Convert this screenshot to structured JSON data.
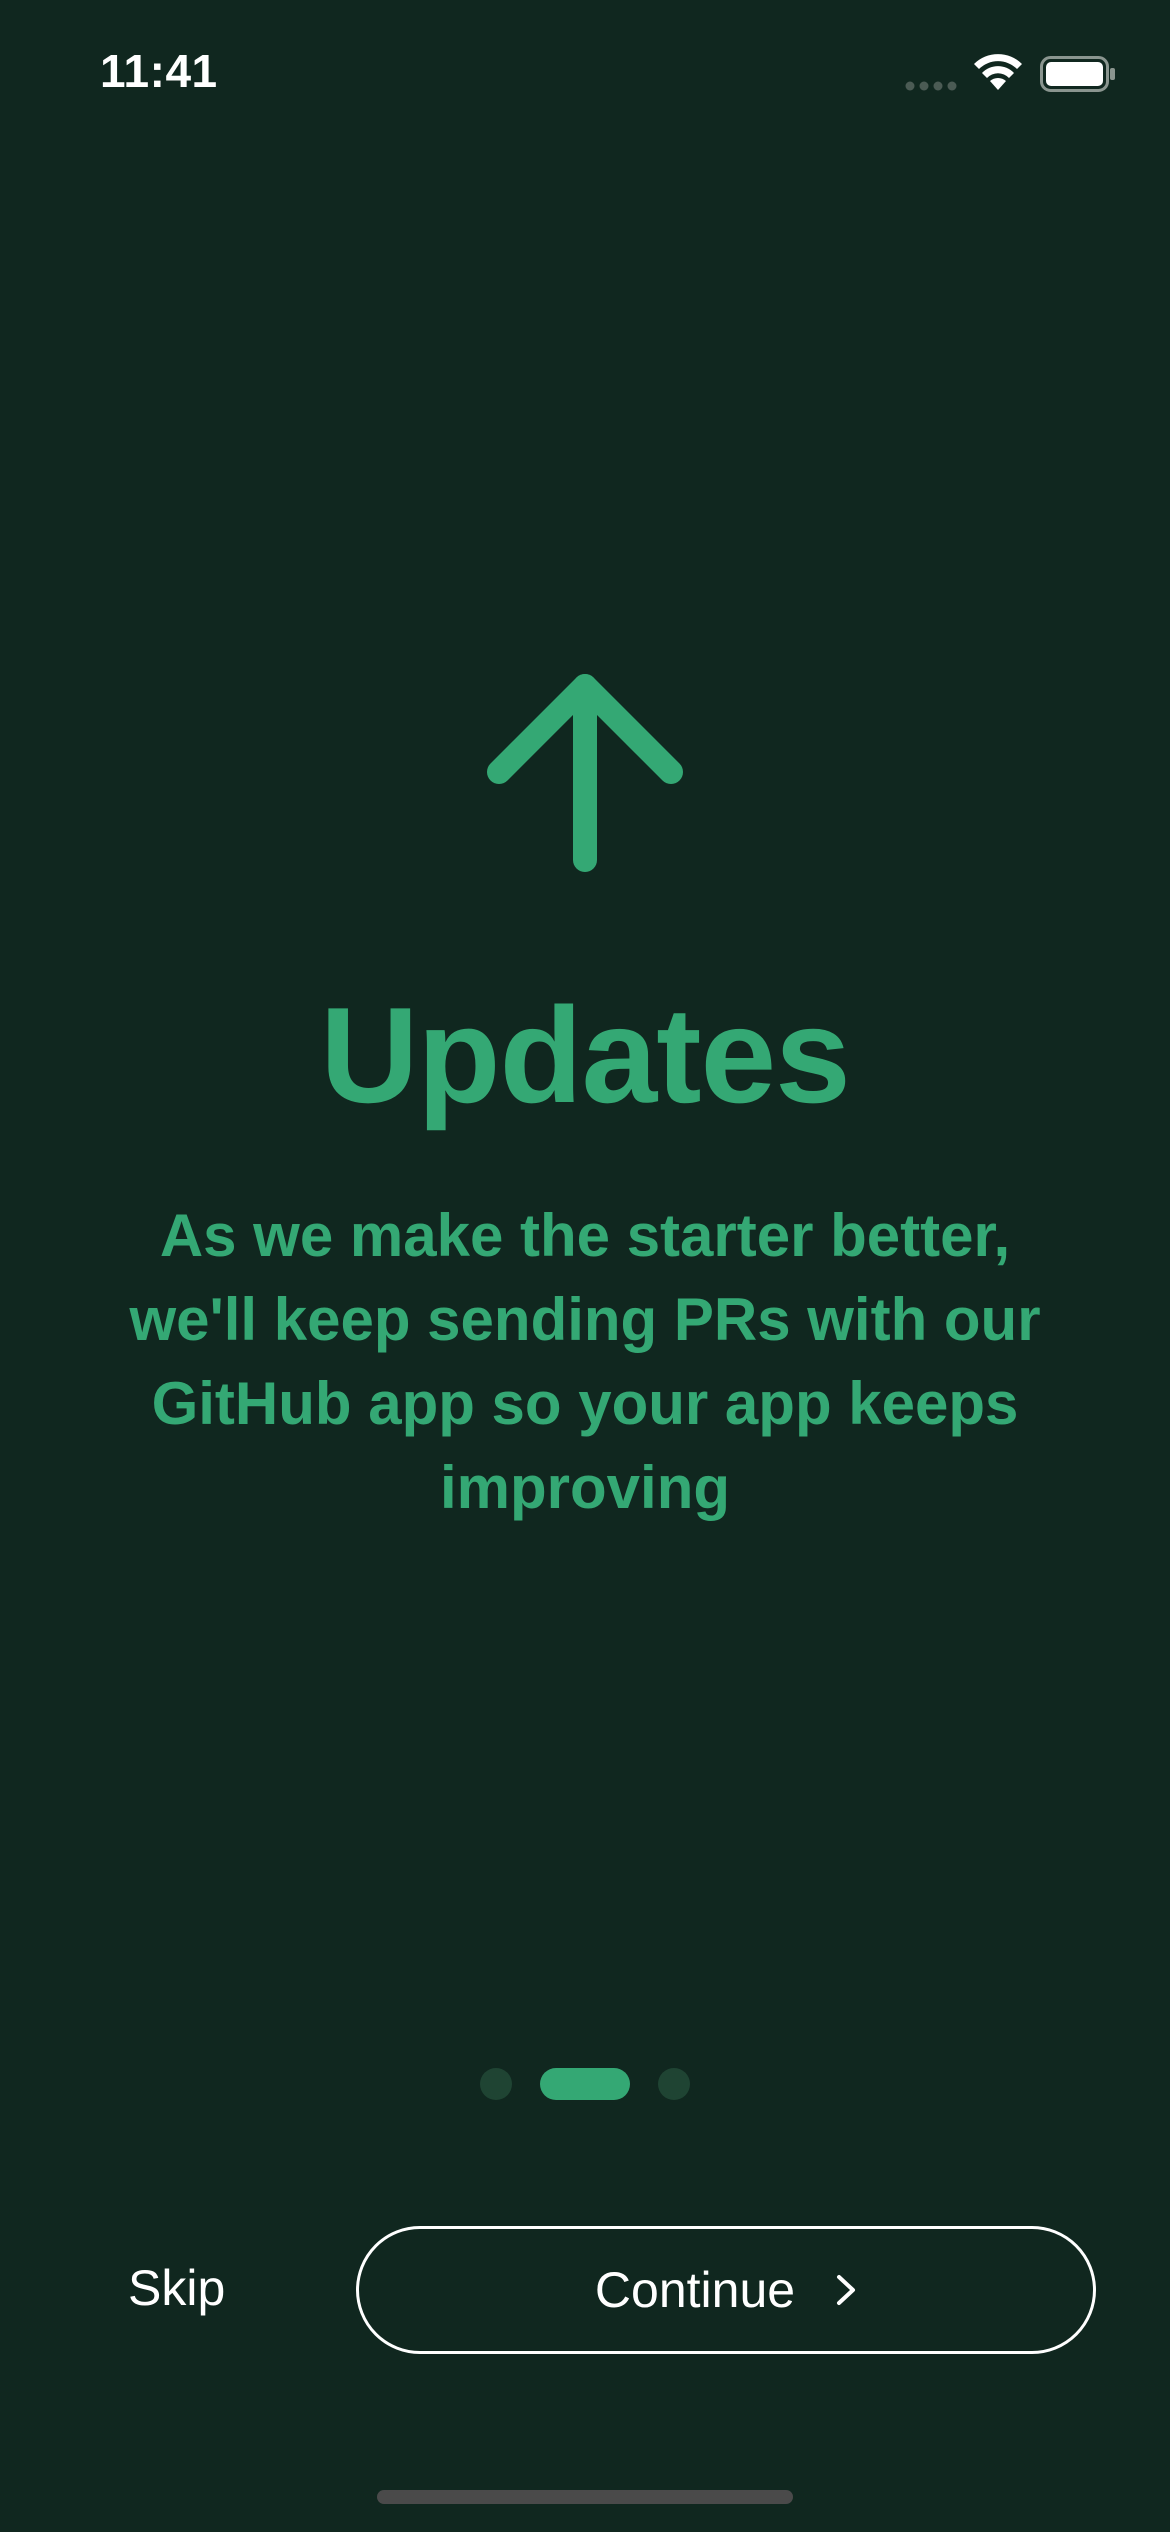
{
  "status_bar": {
    "time": "11:41",
    "icons": [
      "cellular-signal-icon",
      "wifi-icon",
      "battery-icon"
    ]
  },
  "hero": {
    "icon": "arrow-up-icon",
    "title": "Updates",
    "description": "As we make the starter better, we'll keep sending PRs with our GitHub app so your app keeps improving"
  },
  "pagination": {
    "total_pages": 3,
    "current_page": 2
  },
  "actions": {
    "skip_label": "Skip",
    "continue_label": "Continue",
    "continue_icon": "chevron-right-icon"
  },
  "colors": {
    "background": "#10271f",
    "accent": "#34a874",
    "inactive_dot": "#1f4433",
    "text_light": "#ffffff"
  }
}
